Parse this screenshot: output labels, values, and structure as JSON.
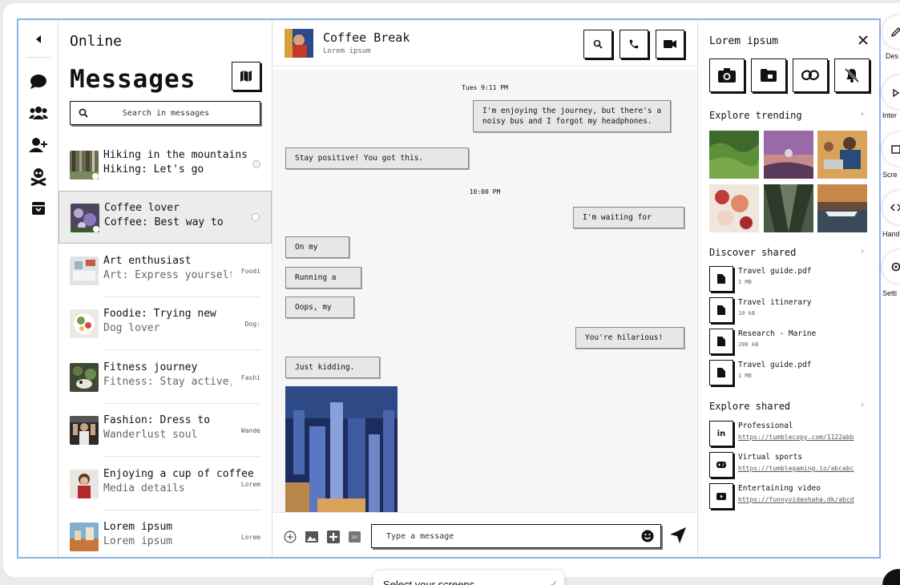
{
  "sidebar": {
    "items": [
      {
        "icon": "collapse-icon"
      },
      {
        "icon": "chat-icon"
      },
      {
        "icon": "groups-icon"
      },
      {
        "icon": "add-user-icon"
      },
      {
        "icon": "skull-icon"
      },
      {
        "icon": "archive-icon"
      }
    ]
  },
  "list": {
    "status": "Online",
    "title": "Messages",
    "search_placeholder": "Search in messages",
    "conversations": [
      {
        "name": "Hiking in the mountains",
        "preview": "Hiking: Let's go",
        "meta": "",
        "unread": true,
        "active": false
      },
      {
        "name": "Coffee lover",
        "preview": "Coffee: Best way to",
        "meta": "",
        "unread": true,
        "active": true
      },
      {
        "name": "Art enthusiast",
        "preview": "Art: Express yourself",
        "meta": "Foodi",
        "unread": false,
        "active": false
      },
      {
        "name": "Foodie: Trying new",
        "preview": "Dog lover",
        "meta": "Dog:",
        "unread": false,
        "active": false
      },
      {
        "name": "Fitness journey",
        "preview": "Fitness: Stay active,",
        "meta": "Fashi",
        "unread": false,
        "active": false
      },
      {
        "name": "Fashion: Dress to",
        "preview": "Wanderlust soul",
        "meta": "Wande",
        "unread": false,
        "active": false
      },
      {
        "name": "Enjoying a cup of coffee",
        "preview": "Media details",
        "meta": "Lorem",
        "unread": false,
        "active": false
      },
      {
        "name": "Lorem ipsum",
        "preview": "Lorem ipsum",
        "meta": "Lorem",
        "unread": false,
        "active": false
      }
    ]
  },
  "chat": {
    "title": "Coffee Break",
    "subtitle": "Lorem ipsum",
    "messages": [
      {
        "type": "time",
        "text": "Tues 9:11 PM"
      },
      {
        "type": "out",
        "text": "I'm enjoying the journey, but there's a\nnoisy bus and I forgot my headphones."
      },
      {
        "type": "in",
        "text": "Stay positive! You got this."
      },
      {
        "type": "time",
        "text": "10:00 PM"
      },
      {
        "type": "out",
        "text": "I'm waiting for"
      },
      {
        "type": "in",
        "text": "On my"
      },
      {
        "type": "in",
        "text": "Running a"
      },
      {
        "type": "in",
        "text": "Oops, my"
      },
      {
        "type": "out",
        "text": "You're hilarious!"
      },
      {
        "type": "in",
        "text": "Just kidding."
      },
      {
        "type": "image",
        "text": ""
      }
    ],
    "composer_placeholder": "Type a message"
  },
  "panel": {
    "title": "Lorem ipsum",
    "quick_actions": [
      "camera-icon",
      "folder-icon",
      "link-icon",
      "mute-icon"
    ],
    "trending_title": "Explore trending",
    "shared_title": "Discover shared",
    "files": [
      {
        "name": "Travel guide.pdf",
        "size": "1 MB"
      },
      {
        "name": "Travel itinerary",
        "size": "10 kB"
      },
      {
        "name": "Research - Marine",
        "size": "200 kB"
      },
      {
        "name": "Travel guide.pdf",
        "size": "1 MB"
      }
    ],
    "explore_title": "Explore shared",
    "links": [
      {
        "name": "Professional",
        "url": "https://tumblecopy.com/1122abb",
        "icon": "linkedin-icon"
      },
      {
        "name": "Virtual sports",
        "url": "https://tumblegaming.io/abcabc",
        "icon": "gamepad-icon"
      },
      {
        "name": "Entertaining video",
        "url": "https://funnyvideohaha.dk/abcd",
        "icon": "youtube-icon"
      }
    ]
  },
  "tools": [
    {
      "label": "Des"
    },
    {
      "label": "Inter"
    },
    {
      "label": "Scre"
    },
    {
      "label": "Hand"
    },
    {
      "label": "Setti"
    }
  ],
  "screen_popup": {
    "label": "Select your screens",
    "check": "✓"
  }
}
